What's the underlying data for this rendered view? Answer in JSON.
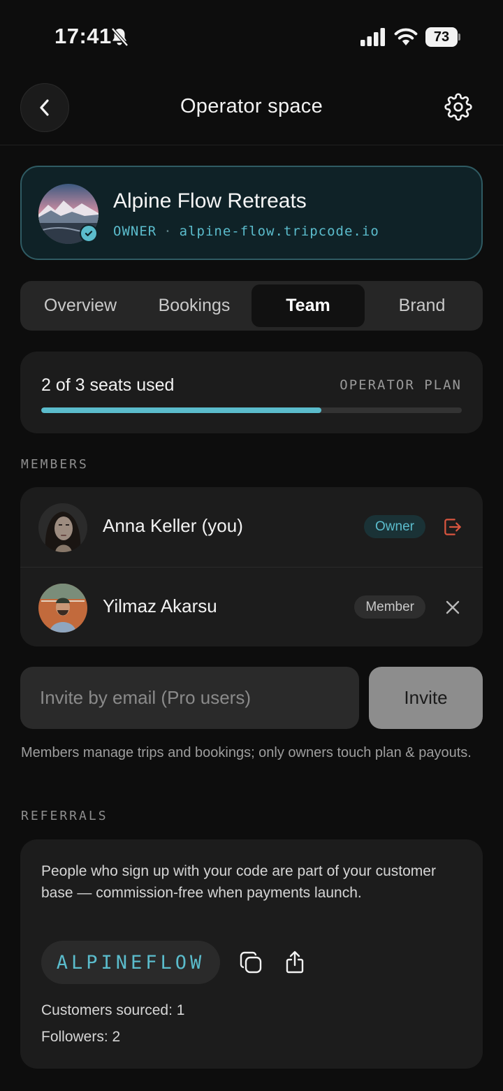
{
  "status_bar": {
    "time": "17:41",
    "battery": "73"
  },
  "header": {
    "title": "Operator space"
  },
  "profile": {
    "name": "Alpine Flow Retreats",
    "role": "OWNER",
    "separator": "·",
    "domain": "alpine-flow.tripcode.io"
  },
  "tabs": [
    {
      "label": "Overview",
      "active": false
    },
    {
      "label": "Bookings",
      "active": false
    },
    {
      "label": "Team",
      "active": true
    },
    {
      "label": "Brand",
      "active": false
    }
  ],
  "seats": {
    "label": "2 of 3 seats used",
    "plan": "OPERATOR PLAN",
    "used": 2,
    "total": 3
  },
  "members_section": {
    "title": "MEMBERS"
  },
  "members": [
    {
      "name": "Anna Keller (you)",
      "role": "Owner",
      "action_icon": "leave-icon"
    },
    {
      "name": "Yilmaz Akarsu",
      "role": "Member",
      "action_icon": "close-icon"
    }
  ],
  "invite": {
    "placeholder": "Invite by email (Pro users)",
    "value": "",
    "button_label": "Invite"
  },
  "help_text": "Members manage trips and bookings; only owners touch plan & payouts.",
  "referrals_section": {
    "title": "REFERRALS"
  },
  "referrals": {
    "description": "People who sign up with your code are part of your customer base — commission-free when payments launch.",
    "code": "ALPINEFLOW",
    "customers_sourced": "Customers sourced: 1",
    "followers": "Followers: 2"
  },
  "colors": {
    "accent": "#5bbccc",
    "background": "#0d0d0d",
    "card": "#1c1c1c",
    "danger": "#d9553f"
  }
}
